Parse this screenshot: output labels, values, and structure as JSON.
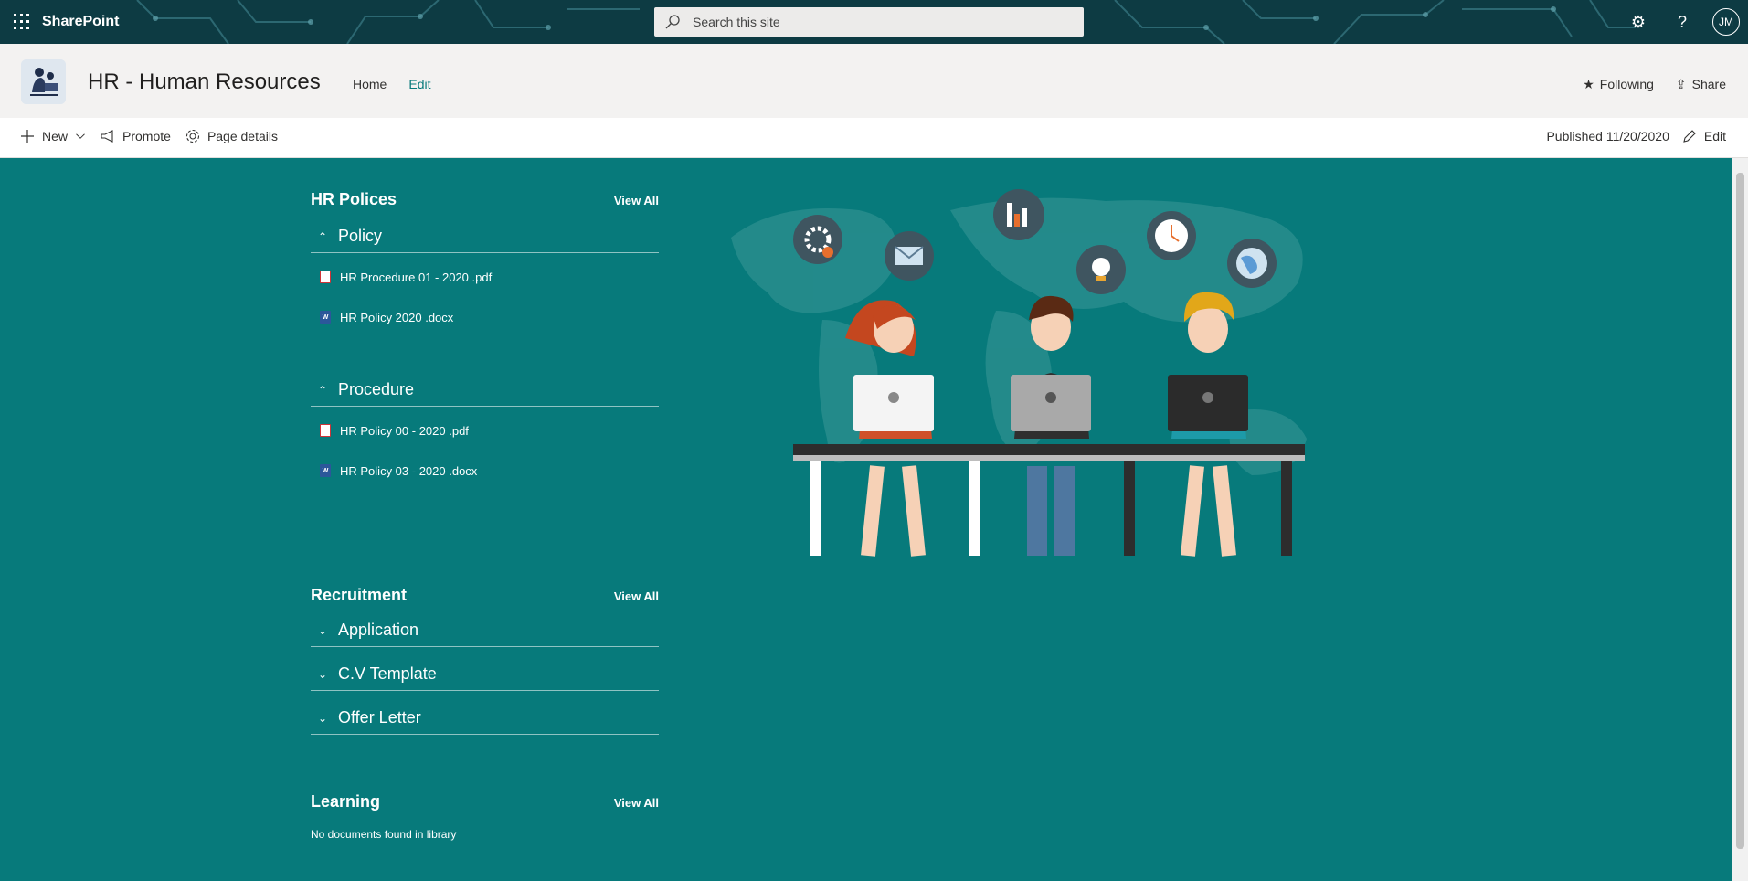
{
  "suitebar": {
    "brand": "SharePoint",
    "search_placeholder": "Search this site",
    "avatar_initials": "JM"
  },
  "site": {
    "title": "HR - Human Resources",
    "nav": [
      "Home",
      "Edit"
    ],
    "following": "Following",
    "share": "Share"
  },
  "commandbar": {
    "new": "New",
    "promote": "Promote",
    "page_details": "Page details",
    "published": "Published 11/20/2020",
    "edit": "Edit"
  },
  "sections": {
    "hr_policies": {
      "title": "HR Polices",
      "view_all": "View All",
      "groups": [
        {
          "name": "Policy",
          "files": [
            {
              "name": "HR Procedure 01 - 2020 .pdf",
              "type": "pdf"
            },
            {
              "name": "HR Policy 2020 .docx",
              "type": "docx"
            }
          ]
        },
        {
          "name": "Procedure",
          "files": [
            {
              "name": "HR Policy 00 - 2020 .pdf",
              "type": "pdf"
            },
            {
              "name": "HR Policy 03 - 2020 .docx",
              "type": "docx"
            }
          ]
        }
      ]
    },
    "recruitment": {
      "title": "Recruitment",
      "view_all": "View All",
      "groups": [
        "Application",
        "C.V Template",
        "Offer Letter"
      ]
    },
    "learning": {
      "title": "Learning",
      "view_all": "View All",
      "empty": "No documents found in library"
    }
  },
  "colors": {
    "accent": "#077a7b",
    "suitebar": "#0d3b43"
  }
}
